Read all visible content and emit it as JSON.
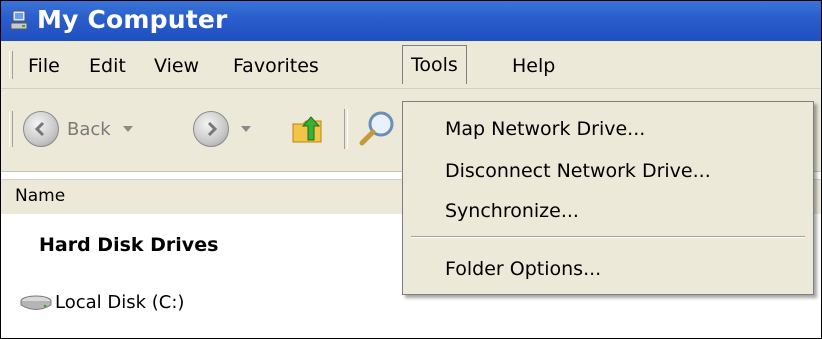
{
  "window": {
    "title": "My Computer"
  },
  "menubar": {
    "items": [
      {
        "label": "File"
      },
      {
        "label": "Edit"
      },
      {
        "label": "View"
      },
      {
        "label": "Favorites"
      },
      {
        "label": "Tools"
      },
      {
        "label": "Help"
      }
    ]
  },
  "toolbar": {
    "back_label": "Back"
  },
  "list_header": {
    "name_column": "Name"
  },
  "content": {
    "group_title": "Hard Disk Drives",
    "items": [
      {
        "label": "Local Disk (C:)"
      }
    ]
  },
  "tools_menu": {
    "items": [
      {
        "label": "Map Network Drive..."
      },
      {
        "label": "Disconnect Network Drive..."
      },
      {
        "label": "Synchronize..."
      },
      {
        "label": "Folder Options..."
      }
    ]
  },
  "colors": {
    "titlebar": "#2b5fcc",
    "menu_bg": "#ece9d8"
  },
  "icons": [
    "my-computer-icon",
    "back-arrow-icon",
    "forward-arrow-icon",
    "up-folder-icon",
    "search-icon",
    "hard-disk-icon"
  ]
}
